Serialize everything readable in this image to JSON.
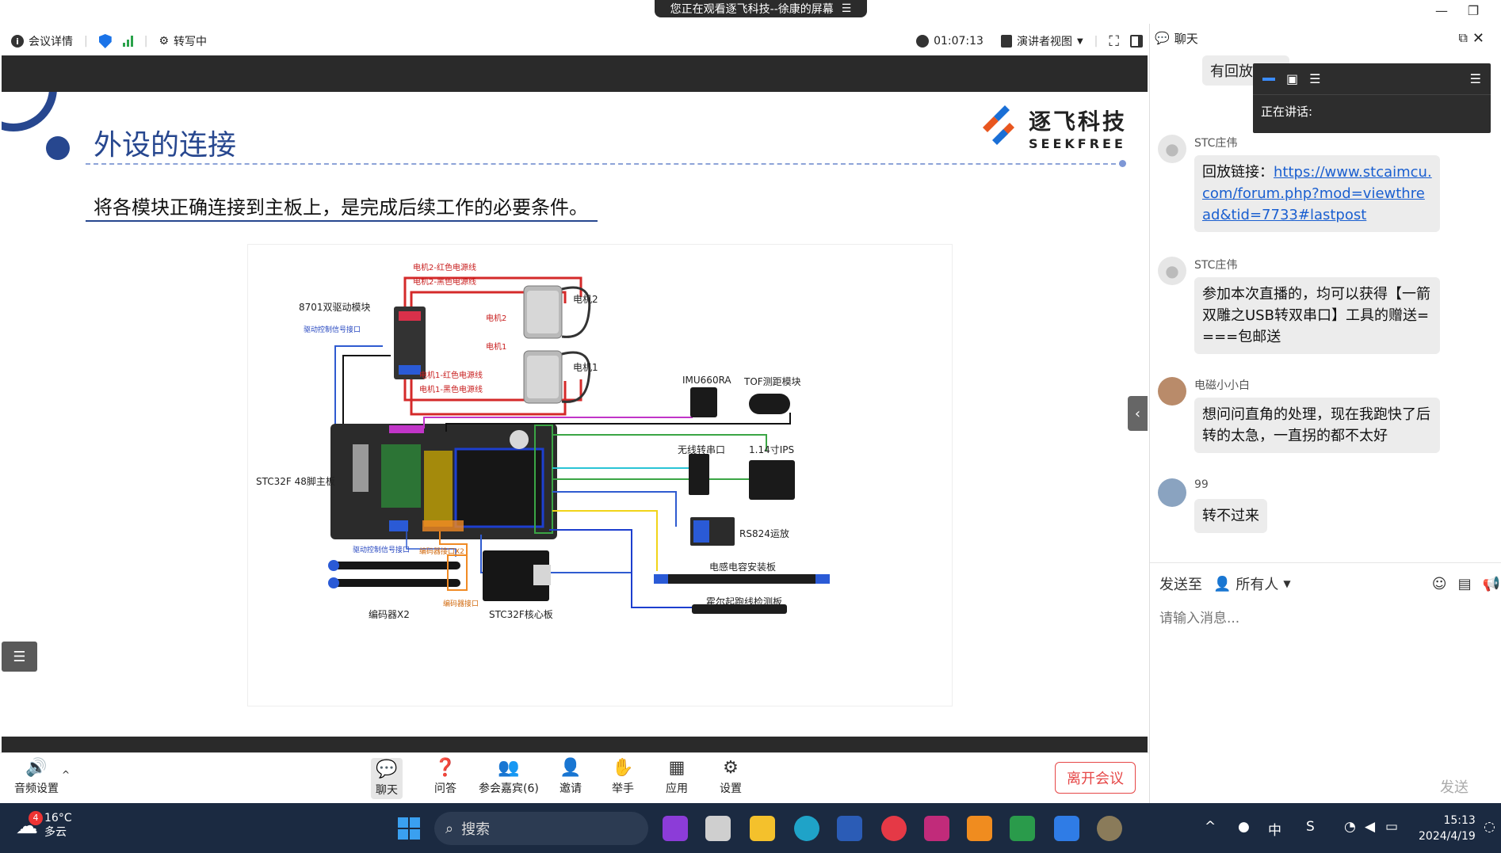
{
  "window": {
    "share_banner": "您正在观看逐飞科技--徐康的屏幕",
    "banner_menu_glyph": "☰",
    "minimize": "—",
    "restore": "❐"
  },
  "toolbar": {
    "meeting_info": "会议详情",
    "transcribing": "转写中",
    "timer": "01:07:13",
    "view_mode": "演讲者视图"
  },
  "slide": {
    "title": "外设的连接",
    "subtitle": "将各模块正确连接到主板上，是完成后续工作的必要条件。",
    "logo_cn": "逐飞科技",
    "logo_en": "SEEKFREE",
    "labels": {
      "driver_module": "8701双驱动模块",
      "motor2": "电机2",
      "motor1": "电机1",
      "motor2_small": "电机2",
      "motor1_small": "电机1",
      "m2_red": "电机2-红色电源线",
      "m2_black": "电机2-黑色电源线",
      "m1_red": "电机1-红色电源线",
      "m1_black": "电机1-黑色电源线",
      "drive_signal_top": "驱动控制信号接口",
      "main_board": "STC32F 48脚主板",
      "imu": "IMU660RA",
      "tof": "TOF测距模块",
      "wireless": "无线转串口",
      "ips": "1.14寸IPS",
      "rs824": "RS824运放",
      "inductor_board": "电感电容安装板",
      "hall_board": "霍尔起跑线检测板",
      "drive_signal_bottom": "驱动控制信号接口",
      "encoder_port": "编码器接口X2",
      "encoder_port_small": "编码器接口",
      "encoder": "编码器X2",
      "core_board": "STC32F核心板"
    }
  },
  "meeting_bar": {
    "audio": "音频设置",
    "chat": "聊天",
    "qa": "问答",
    "participants": "参会嘉宾(6)",
    "invite": "邀请",
    "raise_hand": "举手",
    "apps": "应用",
    "settings": "设置",
    "leave": "离开会议"
  },
  "chat": {
    "title": "聊天",
    "speaking_label": "正在讲话:",
    "partial_message": "有回放吗",
    "messages": [
      {
        "sender": "STC庄伟",
        "text_prefix": "回放链接：",
        "link": "https://www.stcaimcu.com/forum.php?mod=viewthread&tid=7733#lastpost"
      },
      {
        "sender": "STC庄伟",
        "text": "参加本次直播的，均可以获得【一箭双雕之USB转双串口】工具的赠送====包邮送"
      },
      {
        "sender": "电磁小小白",
        "text": "想问问直角的处理，现在我跑快了后转的太急，一直拐的都不太好"
      },
      {
        "sender": "99",
        "text": "转不过来"
      }
    ],
    "send_to": "发送至",
    "recipient": "所有人",
    "input_placeholder": "请输入消息...",
    "send": "发送"
  },
  "taskbar": {
    "weather_temp": "16°C",
    "weather_desc": "多云",
    "weather_badge": "4",
    "search": "搜索",
    "ime": "中",
    "time": "15:13",
    "date": "2024/4/19"
  }
}
